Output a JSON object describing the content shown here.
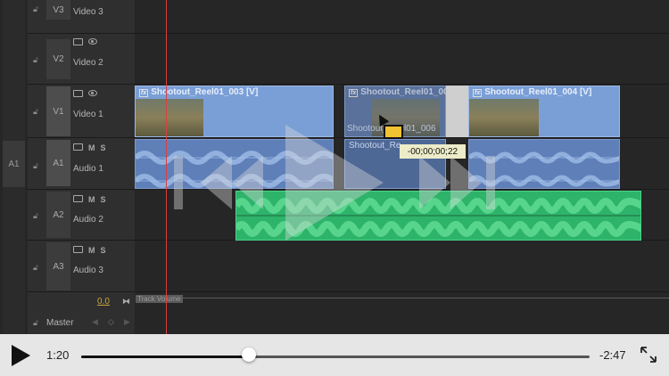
{
  "tracks": {
    "v3": {
      "name": "V3",
      "label": "Video 3"
    },
    "v2": {
      "name": "V2",
      "label": "Video 2"
    },
    "v1": {
      "name": "V1",
      "label": "Video 1"
    },
    "a1": {
      "name": "A1",
      "label": "Audio 1",
      "source": "A1",
      "m": "M",
      "s": "S"
    },
    "a2": {
      "name": "A2",
      "label": "Audio 2",
      "m": "M",
      "s": "S"
    },
    "a3": {
      "name": "A3",
      "label": "Audio 3",
      "m": "M",
      "s": "S"
    },
    "master": {
      "label": "Master",
      "level": "0.0"
    }
  },
  "clips": {
    "v1_left": "Shootout_Reel01_003 [V]",
    "v1_mid": "Shootout_Reel01_006",
    "v1_right": "Shootout_Reel01_004 [V]",
    "a1_mid_title": "Shootout_Re",
    "ghost_label": "Shootout_Reel01_006",
    "track_volume": "Track Volume"
  },
  "tooltip": "-00;00;00;22",
  "player": {
    "current_time": "1:20",
    "remaining_time": "-2:47",
    "progress": 0.329
  },
  "colors": {
    "video_clip": "#7a9fd6",
    "audio_clip": "#5f7fb8",
    "selected_audio": "#2eb36b",
    "playhead": "#d94040",
    "tooltip_bg": "#ececc8"
  },
  "icons": [
    "lock-icon",
    "camera-icon",
    "eye-icon",
    "fx-icon",
    "play-icon",
    "rewind-icon",
    "fast-forward-icon",
    "fullscreen-icon"
  ]
}
